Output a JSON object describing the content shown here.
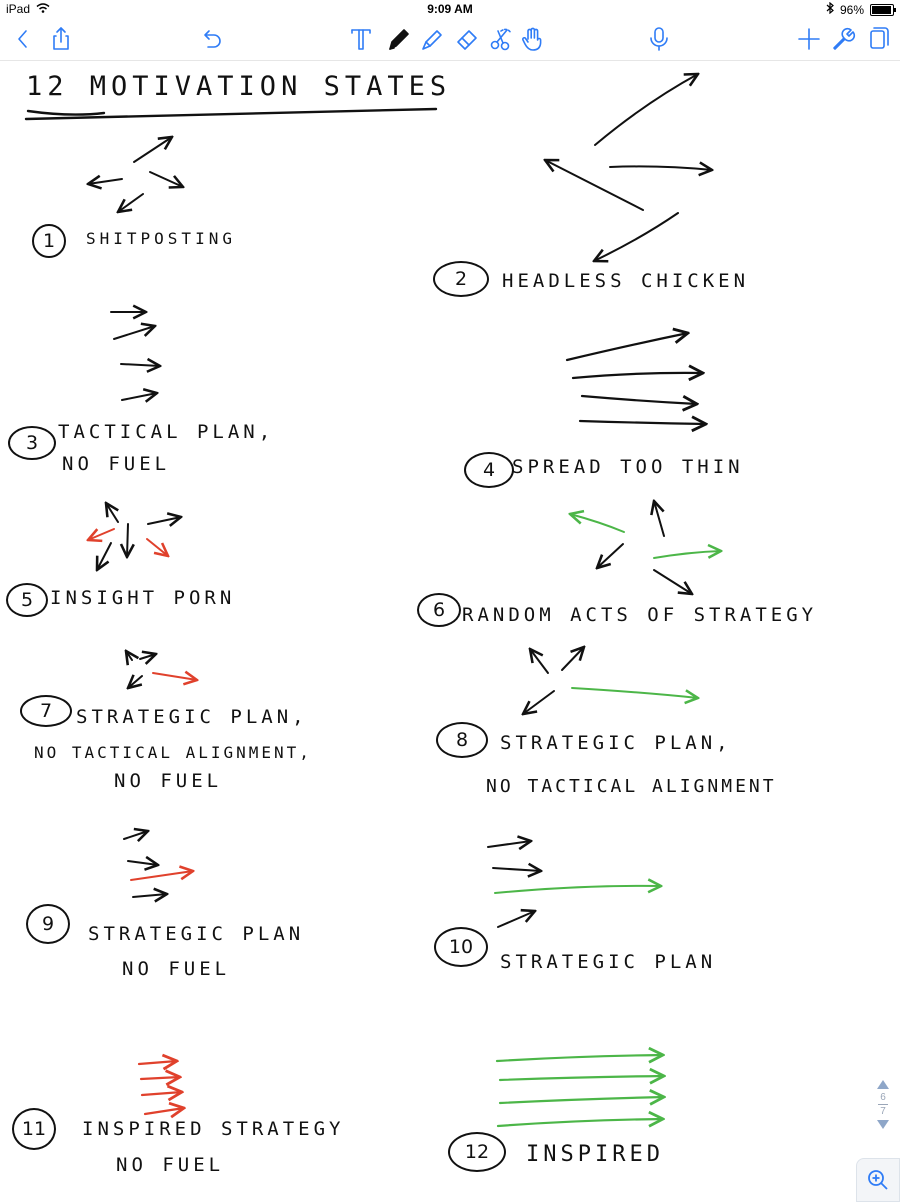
{
  "status_bar": {
    "device": "iPad",
    "time": "9:09 AM",
    "battery": "96%",
    "battery_level": 0.96
  },
  "toolbar": {
    "icons": [
      "back-chevron-icon",
      "share-icon",
      "undo-icon",
      "text-tool-icon",
      "pen-tool-icon",
      "highlighter-tool-icon",
      "eraser-tool-icon",
      "lasso-scissors-icon",
      "hand-tool-icon",
      "microphone-icon",
      "add-icon",
      "wrench-icon",
      "pages-icon"
    ],
    "accent": "#2f7cf6"
  },
  "note": {
    "title": "12 MOTIVATION STATES",
    "ink_colors": {
      "black": "#111111",
      "red": "#e0412c",
      "green": "#4cb648"
    },
    "states": [
      {
        "number": "1",
        "lines": [
          "SHITPOSTING"
        ]
      },
      {
        "number": "2",
        "lines": [
          "HEADLESS CHICKEN"
        ]
      },
      {
        "number": "3",
        "lines": [
          "TACTICAL PLAN,",
          "NO FUEL"
        ]
      },
      {
        "number": "4",
        "lines": [
          "SPREAD TOO THIN"
        ]
      },
      {
        "number": "5",
        "lines": [
          "INSIGHT PORN"
        ]
      },
      {
        "number": "6",
        "lines": [
          "RANDOM ACTS OF STRATEGY"
        ]
      },
      {
        "number": "7",
        "lines": [
          "STRATEGIC PLAN,",
          "NO TACTICAL ALIGNMENT,",
          "NO FUEL"
        ]
      },
      {
        "number": "8",
        "lines": [
          "STRATEGIC PLAN,",
          "NO TACTICAL ALIGNMENT"
        ]
      },
      {
        "number": "9",
        "lines": [
          "STRATEGIC PLAN",
          "NO FUEL"
        ]
      },
      {
        "number": "10",
        "lines": [
          "STRATEGIC PLAN"
        ]
      },
      {
        "number": "11",
        "lines": [
          "INSPIRED STRATEGY",
          "NO FUEL"
        ]
      },
      {
        "number": "12",
        "lines": [
          "INSPIRED"
        ]
      }
    ]
  },
  "pager": {
    "current": "6",
    "total": "7"
  }
}
